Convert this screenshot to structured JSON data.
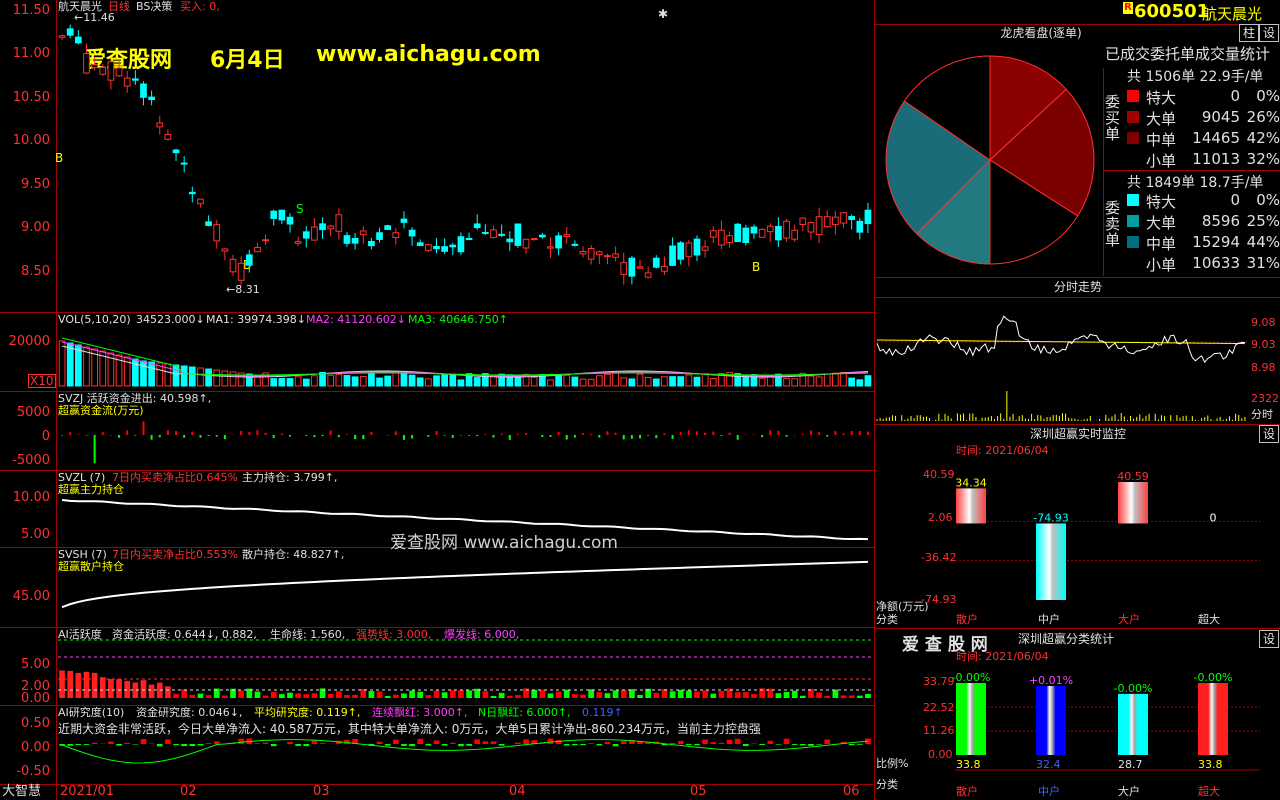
{
  "main_chart": {
    "title": "航天晨光",
    "sub1": "日线",
    "sub2": "BS决策",
    "buy_info": "买入: 0,",
    "high_mark": "←11.46",
    "low_mark": "←8.31",
    "watermark_big": "爱查股网",
    "watermark_date": "6月4日",
    "watermark_url": "www.aichagu.com",
    "y_labels": [
      "11.50",
      "11.00",
      "10.50",
      "10.00",
      "9.50",
      "9.00",
      "8.50"
    ],
    "signals": [
      "B",
      "B",
      "S",
      "B"
    ]
  },
  "vol": {
    "header_name": "VOL(5,10,20)",
    "vol_val": "34523.000↓",
    "ma1": "MA1: 39974.398↓",
    "ma2": "MA2: 41120.602↓",
    "ma3": "MA3: 40646.750↑",
    "y_label": "20000",
    "unit": "X10"
  },
  "svzj": {
    "header": "SVZJ  活跃资金进出: 40.598↑,",
    "subtitle": "超赢资金流(万元)",
    "y_labels": [
      "5000",
      "0",
      "-5000"
    ]
  },
  "svzl": {
    "name": "SVZL (7)",
    "pct": "7日内买卖净占比0.645%",
    "hold": "主力持仓: 3.799↑,",
    "subtitle": "超赢主力持仓",
    "y_labels": [
      "10.00",
      "5.00"
    ],
    "watermark": "爱查股网   www.aichagu.com"
  },
  "svsh": {
    "name": "SVSH (7)",
    "pct": "7日内买卖净占比0.553%",
    "hold": "散户持仓: 48.827↑,",
    "subtitle": "超赢散户持仓",
    "y_labels": [
      "45.00"
    ]
  },
  "ai_active": {
    "name": "AI活跃度",
    "active": "资金活跃度: 0.644↓, 0.882,",
    "life": "生命线: 1.560,",
    "strong": "强势线: 3.000,",
    "burst": "爆发线: 6.000,",
    "y_labels": [
      "5.00",
      "2.00",
      "0.00"
    ]
  },
  "ai_research": {
    "name": "AI研究度(10)",
    "research": "资金研究度: 0.046↓,",
    "avg": "平均研究度: 0.119↑,",
    "streak": "连续飘红: 3.000↑,",
    "n_red": "N日飘红: 6.000↑,",
    "val": "0.119↑",
    "comment": "近期大资金非常活跃，今日大单净流入: 40.587万元，其中特大单净流入: 0万元，大单5日累计净出-860.234万元，当前主力控盘强",
    "y_labels": [
      "0.50",
      "0.00",
      "-0.50"
    ]
  },
  "x_axis": {
    "brand": "大智慧",
    "labels": [
      "2021/01",
      "02",
      "03",
      "04",
      "05",
      "06"
    ]
  },
  "right_header": {
    "r_badge": "R",
    "code": "600501",
    "name": "航天晨光",
    "btn1": "柱",
    "btn2": "设"
  },
  "dragon": {
    "title": "龙虎看盘(逐单)",
    "stat_title": "已成交委托单成交量统计",
    "buy_total": "共 1506单 22.9手/单",
    "sell_total": "共 1849单 18.7手/单",
    "buy_side": "委买单",
    "sell_side": "委卖单",
    "buy_rows": [
      {
        "label": "特大",
        "value": "0",
        "pct": "0%",
        "color": "#ff0000"
      },
      {
        "label": "大单",
        "value": "9045",
        "pct": "26%",
        "color": "#a00000"
      },
      {
        "label": "中单",
        "value": "14465",
        "pct": "42%",
        "color": "#800000"
      },
      {
        "label": "小单",
        "value": "11013",
        "pct": "32%",
        "color": "#000000"
      }
    ],
    "sell_rows": [
      {
        "label": "特大",
        "value": "0",
        "pct": "0%",
        "color": "#00ffff"
      },
      {
        "label": "大单",
        "value": "8596",
        "pct": "25%",
        "color": "#00a0a0"
      },
      {
        "label": "中单",
        "value": "15294",
        "pct": "44%",
        "color": "#007080"
      },
      {
        "label": "小单",
        "value": "10633",
        "pct": "31%",
        "color": "#000000"
      }
    ]
  },
  "intraday": {
    "title": "分时走势",
    "y_labels": [
      "9.08",
      "9.03",
      "8.98"
    ],
    "vol_label": "2322",
    "vol_unit": "分时"
  },
  "monitor": {
    "title": "深圳超赢实时监控",
    "btn": "设",
    "time": "时间: 2021/06/04",
    "y_labels": [
      "40.59",
      "2.06",
      "-36.42",
      "-74.93"
    ],
    "unit": "净额(万元)",
    "category_label": "分类",
    "categories": [
      "散户",
      "中户",
      "大户",
      "超大"
    ],
    "bar_labels": [
      "34.34",
      "-74.93",
      "40.59",
      "0"
    ]
  },
  "classify": {
    "brand": "爱 查 股 网",
    "title": "深圳超赢分类统计",
    "btn": "设",
    "time": "时间: 2021/06/04",
    "y_labels": [
      "33.79",
      "22.52",
      "11.26",
      "0.00"
    ],
    "top_labels": [
      "-0.00%",
      "+0.01%",
      "-0.00%",
      "-0.00%"
    ],
    "bottom_labels": [
      "33.8",
      "32.4",
      "28.7",
      "33.8"
    ],
    "ratio_label": "比例%",
    "category_label": "分类",
    "categories": [
      "散户",
      "中户",
      "大户",
      "超大"
    ]
  },
  "chart_data": [
    {
      "type": "pie",
      "title": "龙虎看盘(逐单)",
      "categories": [
        "买-特大",
        "买-大单",
        "买-中单",
        "买-小单",
        "卖-特大",
        "卖-大单",
        "卖-中单",
        "卖-小单"
      ],
      "values": [
        0,
        9045,
        14465,
        11013,
        0,
        8596,
        15294,
        10633
      ]
    },
    {
      "type": "bar",
      "title": "深圳超赢实时监控",
      "categories": [
        "散户",
        "中户",
        "大户",
        "超大"
      ],
      "values": [
        34.34,
        -74.93,
        40.59,
        0
      ],
      "ylim": [
        -74.93,
        40.59
      ]
    },
    {
      "type": "bar",
      "title": "深圳超赢分类统计",
      "categories": [
        "散户",
        "中户",
        "大户",
        "超大"
      ],
      "values": [
        33.8,
        32.4,
        28.7,
        33.8
      ],
      "ylim": [
        0,
        33.79
      ]
    }
  ],
  "colors": {
    "up": "#ff3030",
    "down": "#00ffff",
    "grid": "#a00000",
    "label": "#ff3030",
    "highlight": "#ffff00"
  }
}
